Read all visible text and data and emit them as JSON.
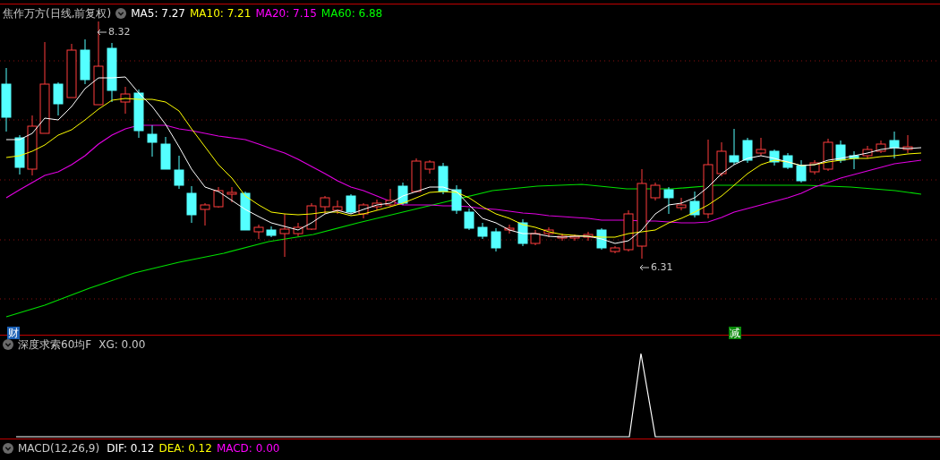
{
  "chart_header": {
    "title": "焦作万方(日线,前复权)",
    "ma_values": [
      {
        "label": "MA5: 7.27",
        "color": "#ffffff"
      },
      {
        "label": "MA10: 7.21",
        "color": "#ffff00"
      },
      {
        "label": "MA20: 7.15",
        "color": "#ff00ff"
      },
      {
        "label": "MA60: 6.88",
        "color": "#00ff00"
      }
    ]
  },
  "price_markers": [
    {
      "text": "8.32",
      "kind": "high"
    },
    {
      "text": "6.31",
      "kind": "low"
    }
  ],
  "event_markers": [
    {
      "text": "财",
      "color": "#1a5fb4"
    },
    {
      "text": "减",
      "color": "#0a8a0a"
    }
  ],
  "indicator_panel": {
    "title": "深度求索60均F",
    "reading": "XG: 0.00"
  },
  "macd_panel": {
    "title": "MACD(12,26,9)",
    "readings": [
      {
        "label": "DIF: 0.12",
        "color": "#ffffff"
      },
      {
        "label": "DEA: 0.12",
        "color": "#ffff00"
      },
      {
        "label": "MACD: 0.00",
        "color": "#ff00ff"
      }
    ]
  }
}
